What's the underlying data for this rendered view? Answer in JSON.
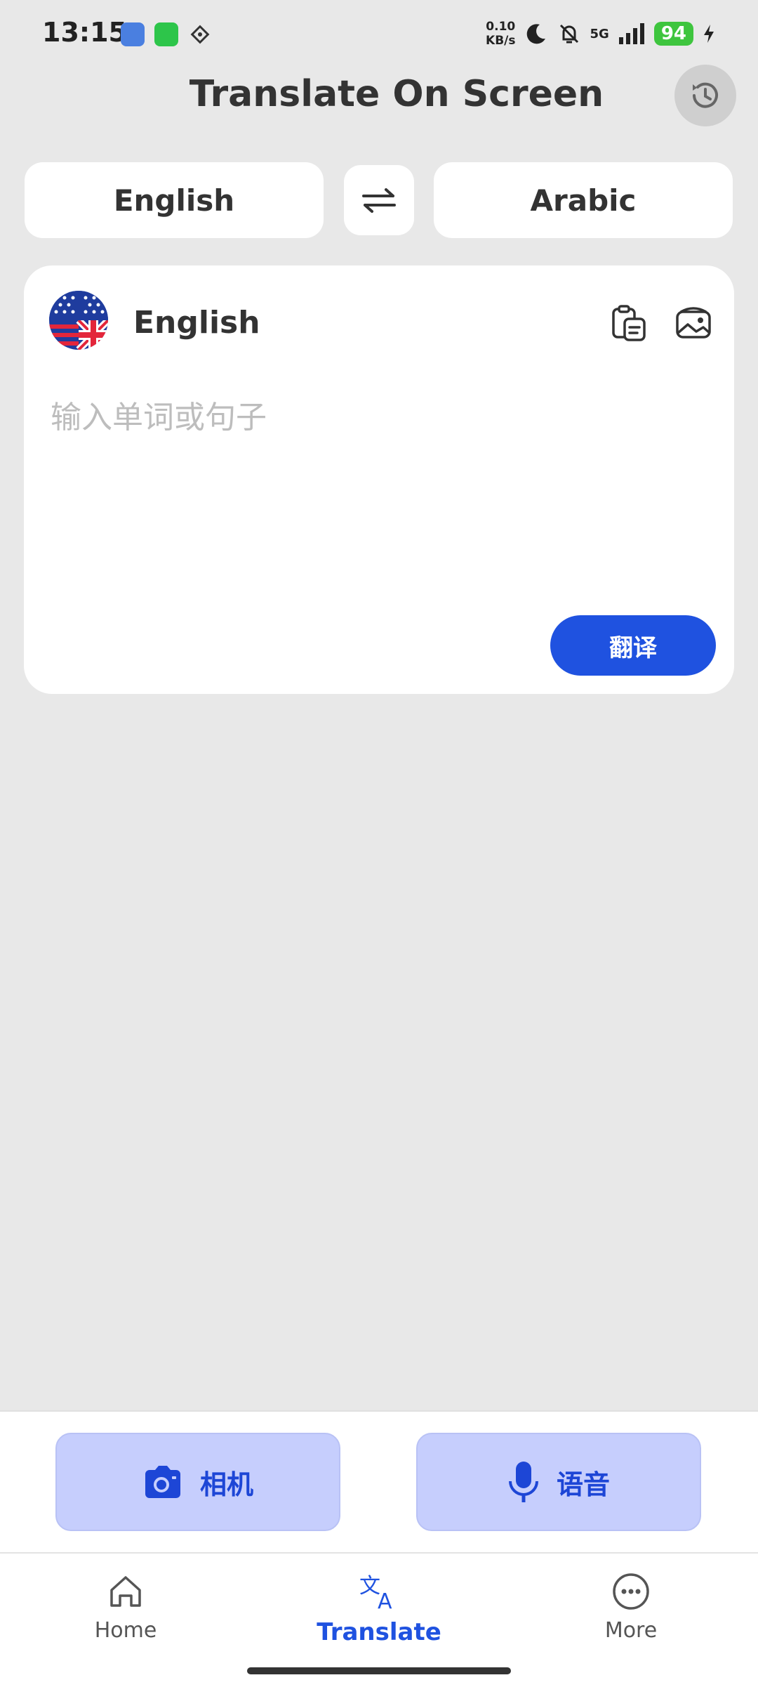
{
  "status_bar": {
    "time": "13:15",
    "net_speed_value": "0.10",
    "net_speed_unit": "KB/s",
    "network": "5G",
    "battery": "94"
  },
  "header": {
    "title": "Translate On Screen"
  },
  "language_bar": {
    "source": "English",
    "target": "Arabic"
  },
  "input_card": {
    "language": "English",
    "placeholder": "输入单词或句子",
    "translate_label": "翻译"
  },
  "actions": {
    "camera_label": "相机",
    "voice_label": "语音"
  },
  "nav": {
    "items": [
      {
        "label": "Home"
      },
      {
        "label": "Translate"
      },
      {
        "label": "More"
      }
    ]
  },
  "colors": {
    "accent": "#1f52e0",
    "action_bg": "#c6cefd",
    "battery": "#3ec53e"
  }
}
